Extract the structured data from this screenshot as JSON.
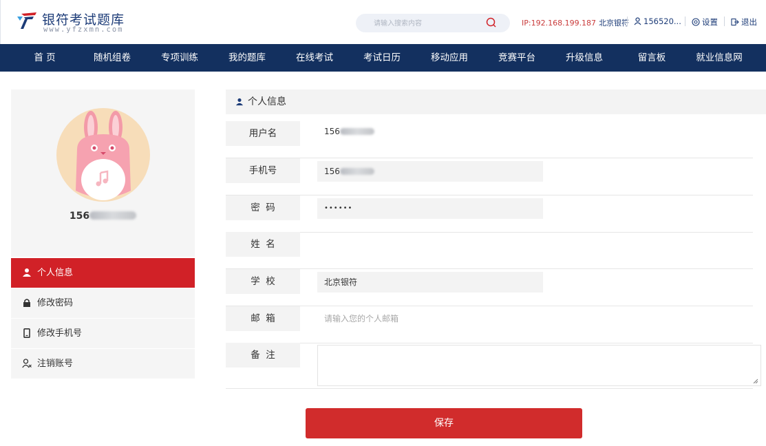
{
  "brand": {
    "title": "银符考试题库",
    "subtitle": "www.yfzxmn.com"
  },
  "header": {
    "search_placeholder": "请输入搜索内容",
    "ip_text": "IP:192.168.199.187",
    "city": "北京银符",
    "user": "156520...",
    "settings": "设置",
    "logout": "退出"
  },
  "nav": [
    "首 页",
    "随机组卷",
    "专项训练",
    "我的题库",
    "在线考试",
    "考试日历",
    "移动应用",
    "竞赛平台",
    "升级信息",
    "留言板",
    "就业信息网"
  ],
  "profile": {
    "username_prefix": "156"
  },
  "menu": [
    {
      "label": "个人信息",
      "icon": "user-icon",
      "active": true
    },
    {
      "label": "修改密码",
      "icon": "lock-icon",
      "active": false
    },
    {
      "label": "修改手机号",
      "icon": "phone-icon",
      "active": false
    },
    {
      "label": "注销账号",
      "icon": "user-remove-icon",
      "active": false
    }
  ],
  "section_title": "个人信息",
  "form": {
    "username": {
      "label": "用户名",
      "value": "156"
    },
    "phone": {
      "label": "手机号",
      "value": "156"
    },
    "password": {
      "label": "密  码",
      "value": "••••••"
    },
    "name": {
      "label": "姓  名",
      "value": ""
    },
    "school": {
      "label": "学  校",
      "value": "北京银符"
    },
    "email": {
      "label": "邮  箱",
      "placeholder": "请输入您的个人邮箱"
    },
    "note": {
      "label": "备  注",
      "value": ""
    }
  },
  "save_label": "保存",
  "colors": {
    "nav_bg": "#13305f",
    "accent_red": "#d12127",
    "brand_blue": "#1d3c78"
  }
}
